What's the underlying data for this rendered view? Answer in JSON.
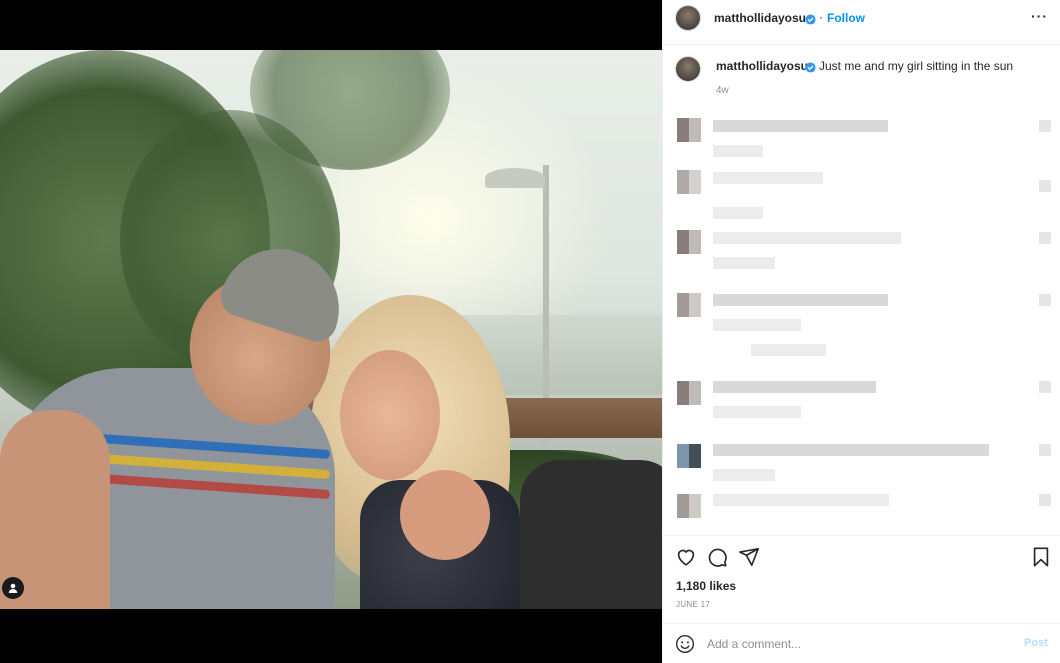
{
  "post": {
    "author": "matthollidayosu",
    "follow_label": "Follow",
    "separator": "·",
    "more_label": "···",
    "caption_text": "Just me and my girl sitting in the sun",
    "caption_time": "4w",
    "likes": "1,180 likes",
    "date": "JUNE 17"
  },
  "comment_box": {
    "placeholder": "Add a comment...",
    "post_label": "Post"
  },
  "colors": {
    "link_blue": "#0095f6",
    "verified_blue": "#3897f0",
    "post_disabled": "#b2dffc"
  },
  "icons": [
    "verified-badge-icon",
    "heart-icon",
    "comment-icon",
    "share-icon",
    "bookmark-icon",
    "emoji-icon",
    "user-tag-icon"
  ]
}
